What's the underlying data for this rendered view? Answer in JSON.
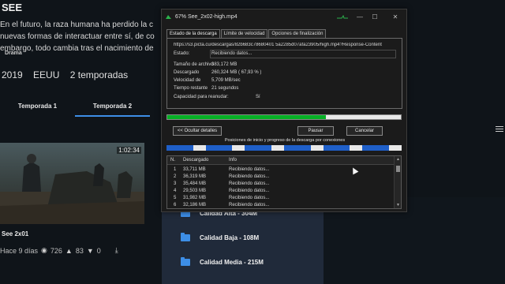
{
  "background": {
    "show_title": "SEE",
    "description": [
      "En el futuro, la raza humana ha perdido la c",
      "nuevas formas de interactuar entre sí, de co",
      "embargo, todo cambia tras el nacimiento de"
    ],
    "genre": "Drama",
    "year": "2019",
    "country": "EEUU",
    "seasons": "2 temporadas",
    "season_tabs": [
      "Temporada 1",
      "Temporada 2"
    ],
    "active_season_index": 1,
    "episode": {
      "duration": "1:02:34",
      "title": "See 2x01",
      "age": "Hace 9 días",
      "views": "726",
      "likes": "83",
      "dislikes": "0"
    },
    "quality_options": [
      "Calidad Alta - 304M",
      "Calidad Baja - 108M",
      "Calidad Media - 215M"
    ],
    "accent_color": "#3d8ee6"
  },
  "dialog": {
    "title": "67% See_2x02-high.mp4",
    "minimize_label": "—",
    "maximize_label": "☐",
    "close_label": "✕",
    "tabs": [
      "Estado de la descarga",
      "Límite de velocidad",
      "Opciones de finalización"
    ],
    "active_tab_index": 0,
    "url": "https://s3.picta.cu/descargas/82b683c78680401 5a2285d07afa23905/high.mp4?Response-Content",
    "info": {
      "status_label": "Estado:",
      "status_value": "Recibiendo datos...",
      "size_label": "Tamaño de archivo",
      "size_value": "383,172  MB",
      "downloaded_label": "Descargado",
      "downloaded_value": "260,324  MB  ( 67,93 % )",
      "speed_label": "Velocidad de",
      "speed_value": "5,709  MB/sec",
      "remaining_label": "Tiempo restante",
      "remaining_value": "21 segundos",
      "resume_label": "Capacidad para reanudar:",
      "resume_value": "Sí"
    },
    "progress_fraction": 0.6793,
    "progress_color": "#06b025",
    "buttons": {
      "hide_details": "<< Ocultar detalles",
      "pause": "Pausar",
      "cancel": "Cancelar"
    },
    "segments_title": "Posiciones de inicio y progreso de la descarga por conexiones",
    "segment_color": "#1f5fc8",
    "connections_table": {
      "columns": [
        "N.",
        "Descargado",
        "Info"
      ],
      "rows": [
        [
          "1",
          "33,711  MB",
          "Recibiendo datos..."
        ],
        [
          "2",
          "36,319  MB",
          "Recibiendo datos..."
        ],
        [
          "3",
          "35,484  MB",
          "Recibiendo datos..."
        ],
        [
          "4",
          "29,503  MB",
          "Recibiendo datos..."
        ],
        [
          "5",
          "31,982  MB",
          "Recibiendo datos..."
        ],
        [
          "6",
          "32,186  MB",
          "Recibiendo datos..."
        ]
      ]
    }
  }
}
